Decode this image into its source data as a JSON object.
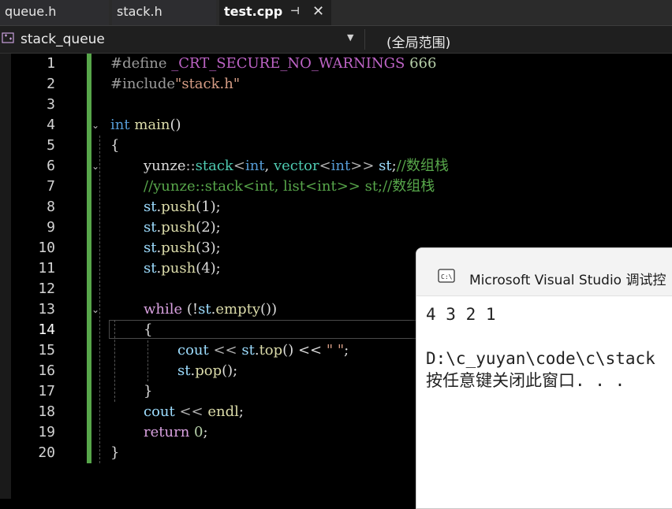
{
  "tabs": [
    {
      "label": "queue.h"
    },
    {
      "label": "stack.h"
    },
    {
      "label": "test.cpp",
      "pin_icon": "pin-icon",
      "close_icon": "close-icon"
    }
  ],
  "navbar": {
    "scope": "stack_queue",
    "global_scope": "(全局范围)"
  },
  "editor": {
    "current_line": 14,
    "line_numbers": [
      "1",
      "2",
      "3",
      "4",
      "5",
      "6",
      "7",
      "8",
      "9",
      "10",
      "11",
      "12",
      "13",
      "14",
      "15",
      "16",
      "17",
      "18",
      "19",
      "20"
    ]
  },
  "code": {
    "l1": {
      "pp": "#define ",
      "macro": "_CRT_SECURE_NO_WARNINGS",
      "num": " 666"
    },
    "l2": {
      "pp": "#include",
      "str": "\"stack.h\""
    },
    "l4": {
      "kw": "int",
      "fn": " main",
      "rest": "()"
    },
    "l5": "{",
    "l6": {
      "ns": "yunze",
      "sep": "::",
      "ty": "stack",
      "a": "<",
      "kw1": "int",
      "b": ", ",
      "ty2": "vector",
      "c": "<",
      "kw2": "int",
      "d": ">> ",
      "var": "st",
      "e": ";",
      "cm": "//数组栈"
    },
    "l7": "//yunze::stack<int, list<int>> st;//数组栈",
    "l8": {
      "var": "st",
      "dot": ".",
      "fn": "push",
      "arg": "(1);"
    },
    "l9": {
      "var": "st",
      "dot": ".",
      "fn": "push",
      "arg": "(2);"
    },
    "l10": {
      "var": "st",
      "dot": ".",
      "fn": "push",
      "arg": "(3);"
    },
    "l11": {
      "var": "st",
      "dot": ".",
      "fn": "push",
      "arg": "(4);"
    },
    "l13": {
      "kw": "while",
      "a": " (!",
      "var": "st",
      "dot": ".",
      "fn": "empty",
      "b": "())"
    },
    "l14": "{",
    "l15": {
      "var": "cout",
      "a": " << ",
      "var2": "st",
      "dot": ".",
      "fn": "top",
      "b": "() << ",
      "str": "\" \"",
      "c": ";"
    },
    "l16": {
      "var": "st",
      "dot": ".",
      "fn": "pop",
      "b": "();"
    },
    "l17": "}",
    "l18": {
      "var": "cout",
      "a": " << ",
      "fn": "endl",
      "b": ";"
    },
    "l19": {
      "kw": "return",
      "num": " 0",
      "b": ";"
    },
    "l20": "}"
  },
  "console": {
    "title": "Microsoft Visual Studio 调试控",
    "output_line1": "4 3 2 1",
    "output_line2": "D:\\c_yuyan\\code\\c\\stack",
    "output_line3": "按任意键关闭此窗口. . ."
  },
  "colors": {
    "keyword": "#569cd6",
    "control_keyword": "#d8a0df",
    "comment": "#57a64a",
    "string": "#d69d85",
    "type": "#4ec9b0",
    "function": "#dcdcaa",
    "variable": "#9cdcfe",
    "change_bar": "#57a64a"
  }
}
